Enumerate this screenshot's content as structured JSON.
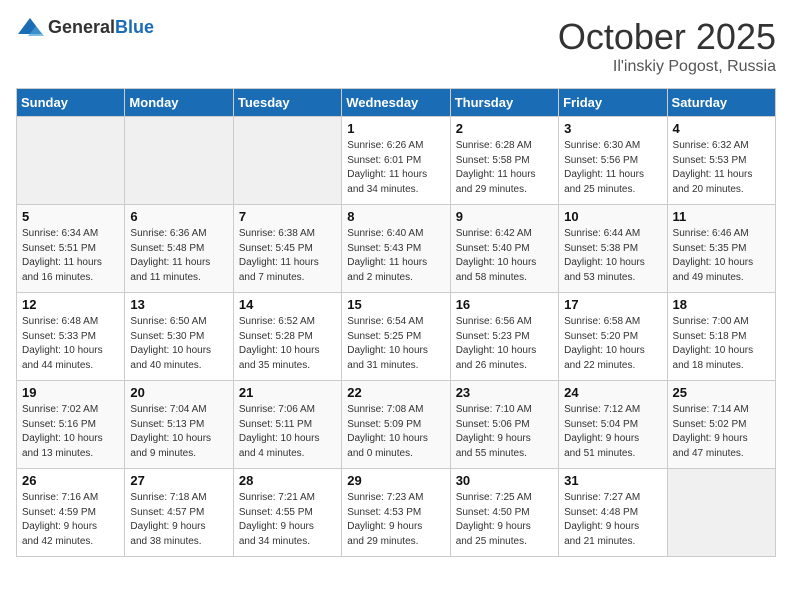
{
  "header": {
    "logo_general": "General",
    "logo_blue": "Blue",
    "month": "October 2025",
    "location": "Il'inskiy Pogost, Russia"
  },
  "weekdays": [
    "Sunday",
    "Monday",
    "Tuesday",
    "Wednesday",
    "Thursday",
    "Friday",
    "Saturday"
  ],
  "weeks": [
    [
      {
        "day": "",
        "info": ""
      },
      {
        "day": "",
        "info": ""
      },
      {
        "day": "",
        "info": ""
      },
      {
        "day": "1",
        "info": "Sunrise: 6:26 AM\nSunset: 6:01 PM\nDaylight: 11 hours\nand 34 minutes."
      },
      {
        "day": "2",
        "info": "Sunrise: 6:28 AM\nSunset: 5:58 PM\nDaylight: 11 hours\nand 29 minutes."
      },
      {
        "day": "3",
        "info": "Sunrise: 6:30 AM\nSunset: 5:56 PM\nDaylight: 11 hours\nand 25 minutes."
      },
      {
        "day": "4",
        "info": "Sunrise: 6:32 AM\nSunset: 5:53 PM\nDaylight: 11 hours\nand 20 minutes."
      }
    ],
    [
      {
        "day": "5",
        "info": "Sunrise: 6:34 AM\nSunset: 5:51 PM\nDaylight: 11 hours\nand 16 minutes."
      },
      {
        "day": "6",
        "info": "Sunrise: 6:36 AM\nSunset: 5:48 PM\nDaylight: 11 hours\nand 11 minutes."
      },
      {
        "day": "7",
        "info": "Sunrise: 6:38 AM\nSunset: 5:45 PM\nDaylight: 11 hours\nand 7 minutes."
      },
      {
        "day": "8",
        "info": "Sunrise: 6:40 AM\nSunset: 5:43 PM\nDaylight: 11 hours\nand 2 minutes."
      },
      {
        "day": "9",
        "info": "Sunrise: 6:42 AM\nSunset: 5:40 PM\nDaylight: 10 hours\nand 58 minutes."
      },
      {
        "day": "10",
        "info": "Sunrise: 6:44 AM\nSunset: 5:38 PM\nDaylight: 10 hours\nand 53 minutes."
      },
      {
        "day": "11",
        "info": "Sunrise: 6:46 AM\nSunset: 5:35 PM\nDaylight: 10 hours\nand 49 minutes."
      }
    ],
    [
      {
        "day": "12",
        "info": "Sunrise: 6:48 AM\nSunset: 5:33 PM\nDaylight: 10 hours\nand 44 minutes."
      },
      {
        "day": "13",
        "info": "Sunrise: 6:50 AM\nSunset: 5:30 PM\nDaylight: 10 hours\nand 40 minutes."
      },
      {
        "day": "14",
        "info": "Sunrise: 6:52 AM\nSunset: 5:28 PM\nDaylight: 10 hours\nand 35 minutes."
      },
      {
        "day": "15",
        "info": "Sunrise: 6:54 AM\nSunset: 5:25 PM\nDaylight: 10 hours\nand 31 minutes."
      },
      {
        "day": "16",
        "info": "Sunrise: 6:56 AM\nSunset: 5:23 PM\nDaylight: 10 hours\nand 26 minutes."
      },
      {
        "day": "17",
        "info": "Sunrise: 6:58 AM\nSunset: 5:20 PM\nDaylight: 10 hours\nand 22 minutes."
      },
      {
        "day": "18",
        "info": "Sunrise: 7:00 AM\nSunset: 5:18 PM\nDaylight: 10 hours\nand 18 minutes."
      }
    ],
    [
      {
        "day": "19",
        "info": "Sunrise: 7:02 AM\nSunset: 5:16 PM\nDaylight: 10 hours\nand 13 minutes."
      },
      {
        "day": "20",
        "info": "Sunrise: 7:04 AM\nSunset: 5:13 PM\nDaylight: 10 hours\nand 9 minutes."
      },
      {
        "day": "21",
        "info": "Sunrise: 7:06 AM\nSunset: 5:11 PM\nDaylight: 10 hours\nand 4 minutes."
      },
      {
        "day": "22",
        "info": "Sunrise: 7:08 AM\nSunset: 5:09 PM\nDaylight: 10 hours\nand 0 minutes."
      },
      {
        "day": "23",
        "info": "Sunrise: 7:10 AM\nSunset: 5:06 PM\nDaylight: 9 hours\nand 55 minutes."
      },
      {
        "day": "24",
        "info": "Sunrise: 7:12 AM\nSunset: 5:04 PM\nDaylight: 9 hours\nand 51 minutes."
      },
      {
        "day": "25",
        "info": "Sunrise: 7:14 AM\nSunset: 5:02 PM\nDaylight: 9 hours\nand 47 minutes."
      }
    ],
    [
      {
        "day": "26",
        "info": "Sunrise: 7:16 AM\nSunset: 4:59 PM\nDaylight: 9 hours\nand 42 minutes."
      },
      {
        "day": "27",
        "info": "Sunrise: 7:18 AM\nSunset: 4:57 PM\nDaylight: 9 hours\nand 38 minutes."
      },
      {
        "day": "28",
        "info": "Sunrise: 7:21 AM\nSunset: 4:55 PM\nDaylight: 9 hours\nand 34 minutes."
      },
      {
        "day": "29",
        "info": "Sunrise: 7:23 AM\nSunset: 4:53 PM\nDaylight: 9 hours\nand 29 minutes."
      },
      {
        "day": "30",
        "info": "Sunrise: 7:25 AM\nSunset: 4:50 PM\nDaylight: 9 hours\nand 25 minutes."
      },
      {
        "day": "31",
        "info": "Sunrise: 7:27 AM\nSunset: 4:48 PM\nDaylight: 9 hours\nand 21 minutes."
      },
      {
        "day": "",
        "info": ""
      }
    ]
  ]
}
